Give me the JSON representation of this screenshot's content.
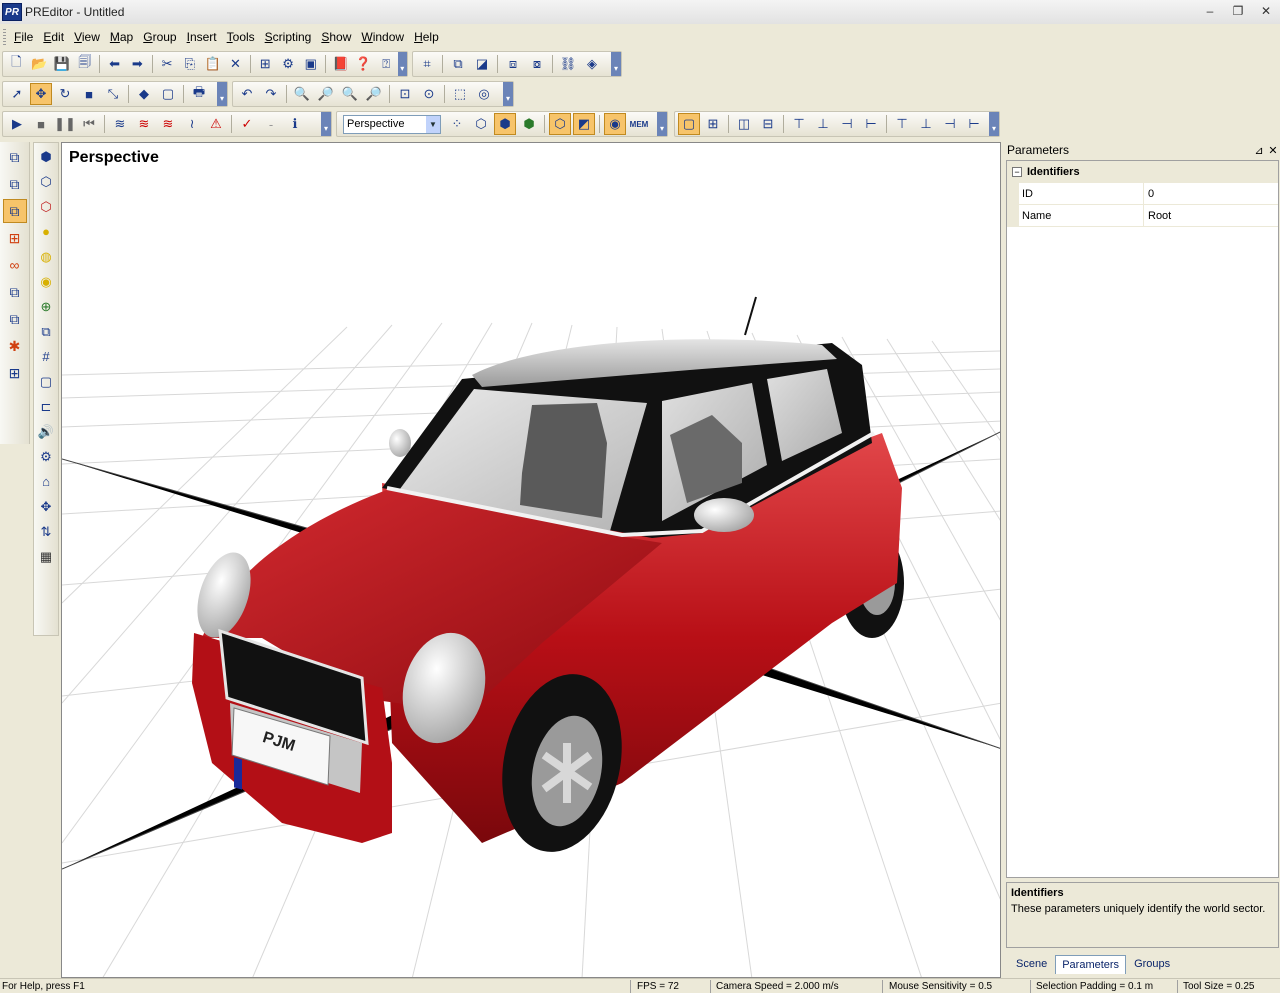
{
  "window": {
    "title": "PREditor - Untitled",
    "app_icon_text": "PR",
    "minimize": "–",
    "restore": "❐",
    "close": "✕"
  },
  "menu": [
    "File",
    "Edit",
    "View",
    "Map",
    "Group",
    "Insert",
    "Tools",
    "Scripting",
    "Show",
    "Window",
    "Help"
  ],
  "toolbar": {
    "view_combo": "Perspective"
  },
  "viewport": {
    "label": "Perspective",
    "plate_text": "PJM"
  },
  "colors": {
    "car_body": "#c1131a",
    "car_roof": "#bdbdbd",
    "accent": "#f7c46a"
  },
  "panel": {
    "title": "Parameters",
    "pin_icon": "⊿",
    "close_icon": "✕",
    "category": {
      "toggle": "−",
      "label": "Identifiers"
    },
    "rows": [
      {
        "name": "ID",
        "value": "0"
      },
      {
        "name": "Name",
        "value": "Root"
      }
    ],
    "description": {
      "title": "Identifiers",
      "text": "These parameters uniquely identify the world sector."
    },
    "tabs": [
      "Scene",
      "Parameters",
      "Groups"
    ]
  },
  "status": {
    "help": "For Help, press F1",
    "fps": "FPS = 72",
    "camera_speed": "Camera Speed = 2.000 m/s",
    "mouse_sensitivity": "Mouse Sensitivity = 0.5",
    "selection_padding": "Selection Padding = 0.1 m",
    "tool_size": "Tool Size = 0.25"
  }
}
